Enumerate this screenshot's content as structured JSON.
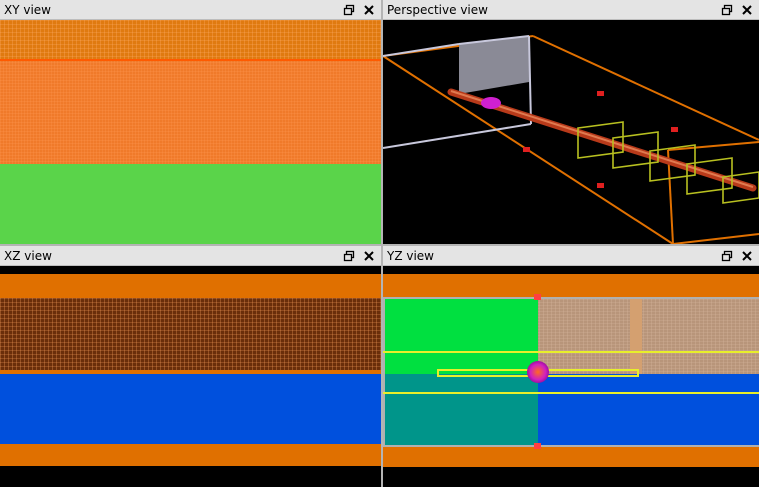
{
  "panes": {
    "xy": {
      "title": "XY view"
    },
    "perspective": {
      "title": "Perspective view"
    },
    "xz": {
      "title": "XZ view"
    },
    "yz": {
      "title": "YZ view"
    }
  },
  "icons": {
    "restore": "restore-window-icon",
    "close": "close-icon"
  },
  "colors": {
    "titlebar": "#e4e4e4",
    "orange_material": "#e07000",
    "orange_mesh": "#ff8c3a",
    "green_material": "#5ad44a",
    "bright_green": "#00e040",
    "blue_material": "#0050dd",
    "teal_material": "#00958a",
    "yellow_outline": "#e8ef2a",
    "magenta_source": "#d020d0",
    "background": "#000000"
  }
}
